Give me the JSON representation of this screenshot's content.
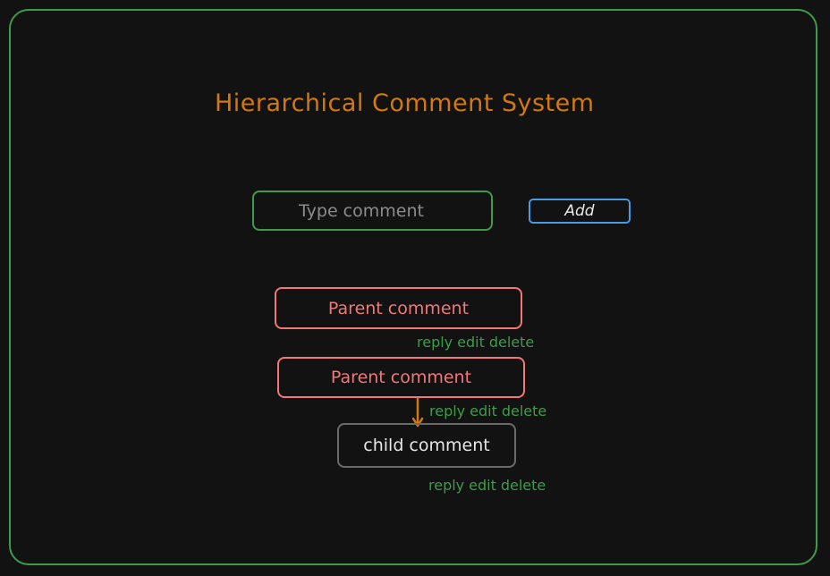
{
  "header": {
    "title": "Hierarchical Comment System"
  },
  "composer": {
    "placeholder": "Type comment",
    "add_label": "Add"
  },
  "comments": [
    {
      "text": "Parent comment",
      "level": "parent",
      "actions": [
        "reply",
        "edit",
        "delete"
      ]
    },
    {
      "text": "Parent comment",
      "level": "parent",
      "actions": [
        "reply",
        "edit",
        "delete"
      ]
    },
    {
      "text": "child comment",
      "level": "child",
      "actions": [
        "reply",
        "edit",
        "delete"
      ]
    }
  ],
  "colors": {
    "frame": "#3f9b4a",
    "title": "#d2780e",
    "parent": "#f07878",
    "child_border": "#6a6a6a",
    "button": "#4a9ae4",
    "actions": "#3f9b4a",
    "connector": "#d2780e"
  }
}
